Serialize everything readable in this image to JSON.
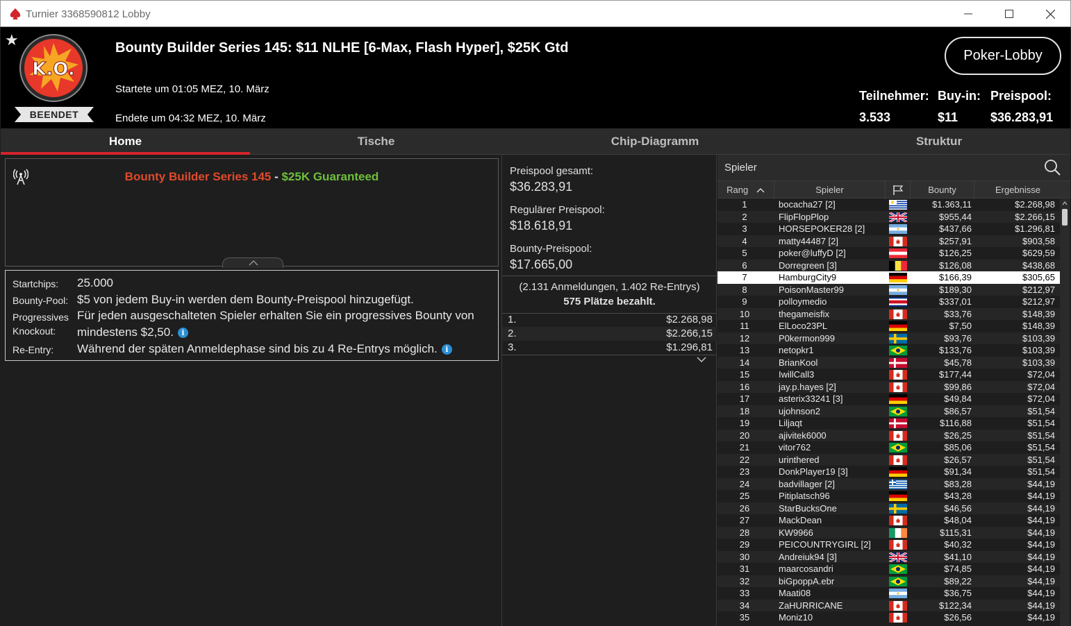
{
  "window": {
    "title": "Turnier 3368590812 Lobby"
  },
  "header": {
    "status": "BEENDET",
    "logo_text": "K.O.",
    "title": "Bounty Builder Series 145: $11 NLHE [6-Max, Flash Hyper], $25K Gtd",
    "started": "Startete um 01:05 MEZ, 10. März",
    "ended": "Endete um 04:32 MEZ, 10. März",
    "lobby_button": "Poker-Lobby",
    "stats": [
      {
        "label": "Teilnehmer:",
        "value": "3.533"
      },
      {
        "label": "Buy-in:",
        "value": "$11"
      },
      {
        "label": "Preispool:",
        "value": "$36.283,91"
      }
    ]
  },
  "tabs": [
    "Home",
    "Tische",
    "Chip-Diagramm",
    "Struktur"
  ],
  "active_tab": "Home",
  "news": {
    "title_red": "Bounty Builder Series 145",
    "title_sep": " - ",
    "title_green": "$25K Guaranteed"
  },
  "info": {
    "startchips_label": "Startchips:",
    "startchips_value": "25.000",
    "bountypool_label": "Bounty-Pool:",
    "bountypool_value": "$5 von jedem Buy-in werden dem Bounty-Preispool hinzugefügt.",
    "progressive_label_1": "Progressives",
    "progressive_label_2": "Knockout:",
    "progressive_value_1": "Für jeden ausgeschalteten Spieler erhalten Sie ein progressives Bounty von",
    "progressive_value_2": "mindestens $2,50.",
    "reentry_label": "Re-Entry:",
    "reentry_value": "Während der späten Anmeldephase sind bis zu 4 Re-Entrys möglich."
  },
  "prizepool": {
    "total_label": "Preispool gesamt:",
    "total_value": "$36.283,91",
    "regular_label": "Regulärer Preispool:",
    "regular_value": "$18.618,91",
    "bounty_label": "Bounty-Preispool:",
    "bounty_value": "$17.665,00",
    "entries": "(2.131 Anmeldungen, 1.402 Re-Entrys)",
    "paid": "575 Plätze bezahlt.",
    "places": [
      {
        "pos": "1.",
        "amount": "$2.268,98"
      },
      {
        "pos": "2.",
        "amount": "$2.266,15"
      },
      {
        "pos": "3.",
        "amount": "$1.296,81"
      }
    ]
  },
  "players": {
    "search_label": "Spieler",
    "columns": [
      "Rang",
      "Spieler",
      "",
      "Bounty",
      "Ergebnisse"
    ],
    "highlighted_rank": "7",
    "rows": [
      {
        "rank": "1",
        "name": "bocacha27 [2]",
        "flag": "uy",
        "bounty": "$1.363,11",
        "result": "$2.268,98"
      },
      {
        "rank": "2",
        "name": "FlipFlopPlop",
        "flag": "gb",
        "bounty": "$955,44",
        "result": "$2.266,15"
      },
      {
        "rank": "3",
        "name": "HORSEPOKER28 [2]",
        "flag": "ar",
        "bounty": "$437,66",
        "result": "$1.296,81"
      },
      {
        "rank": "4",
        "name": "matty44487 [2]",
        "flag": "ca",
        "bounty": "$257,91",
        "result": "$903,58"
      },
      {
        "rank": "5",
        "name": "poker@luffyD [2]",
        "flag": "at",
        "bounty": "$126,25",
        "result": "$629,59"
      },
      {
        "rank": "6",
        "name": "Dorregreen [3]",
        "flag": "be",
        "bounty": "$126,08",
        "result": "$438,68"
      },
      {
        "rank": "7",
        "name": "HamburgCity9",
        "flag": "de",
        "bounty": "$166,39",
        "result": "$305,65"
      },
      {
        "rank": "8",
        "name": "PoisonMaster99",
        "flag": "ar",
        "bounty": "$189,30",
        "result": "$212,97"
      },
      {
        "rank": "9",
        "name": "polloymedio",
        "flag": "cr",
        "bounty": "$337,01",
        "result": "$212,97"
      },
      {
        "rank": "10",
        "name": "thegameisfix",
        "flag": "ca",
        "bounty": "$33,76",
        "result": "$148,39"
      },
      {
        "rank": "11",
        "name": "ElLoco23PL",
        "flag": "de",
        "bounty": "$7,50",
        "result": "$148,39"
      },
      {
        "rank": "12",
        "name": "P0kermon999",
        "flag": "se",
        "bounty": "$93,76",
        "result": "$103,39"
      },
      {
        "rank": "13",
        "name": "netopkr1",
        "flag": "br",
        "bounty": "$133,76",
        "result": "$103,39"
      },
      {
        "rank": "14",
        "name": "BrianKool",
        "flag": "dk",
        "bounty": "$45,78",
        "result": "$103,39"
      },
      {
        "rank": "15",
        "name": "IwillCall3",
        "flag": "ca",
        "bounty": "$177,44",
        "result": "$72,04"
      },
      {
        "rank": "16",
        "name": "jay.p.hayes [2]",
        "flag": "ca",
        "bounty": "$99,86",
        "result": "$72,04"
      },
      {
        "rank": "17",
        "name": "asterix33241 [3]",
        "flag": "de",
        "bounty": "$49,84",
        "result": "$72,04"
      },
      {
        "rank": "18",
        "name": "ujohnson2",
        "flag": "br",
        "bounty": "$86,57",
        "result": "$51,54"
      },
      {
        "rank": "19",
        "name": "Liljaqt",
        "flag": "dk",
        "bounty": "$116,88",
        "result": "$51,54"
      },
      {
        "rank": "20",
        "name": "ajivitek6000",
        "flag": "ca",
        "bounty": "$26,25",
        "result": "$51,54"
      },
      {
        "rank": "21",
        "name": "vitor762",
        "flag": "br",
        "bounty": "$85,06",
        "result": "$51,54"
      },
      {
        "rank": "22",
        "name": "urinthered",
        "flag": "ca",
        "bounty": "$26,57",
        "result": "$51,54"
      },
      {
        "rank": "23",
        "name": "DonkPlayer19 [3]",
        "flag": "de",
        "bounty": "$91,34",
        "result": "$51,54"
      },
      {
        "rank": "24",
        "name": "badvillager [2]",
        "flag": "gr",
        "bounty": "$83,28",
        "result": "$44,19"
      },
      {
        "rank": "25",
        "name": "Pitiplatsch96",
        "flag": "de",
        "bounty": "$43,28",
        "result": "$44,19"
      },
      {
        "rank": "26",
        "name": "StarBucksOne",
        "flag": "se",
        "bounty": "$46,56",
        "result": "$44,19"
      },
      {
        "rank": "27",
        "name": "MackDean",
        "flag": "ca",
        "bounty": "$48,04",
        "result": "$44,19"
      },
      {
        "rank": "28",
        "name": "KW9966",
        "flag": "ie",
        "bounty": "$115,31",
        "result": "$44,19"
      },
      {
        "rank": "29",
        "name": "PEICOUNTRYGIRL [2]",
        "flag": "ca",
        "bounty": "$40,32",
        "result": "$44,19"
      },
      {
        "rank": "30",
        "name": "Andreiuk94 [3]",
        "flag": "gb",
        "bounty": "$41,10",
        "result": "$44,19"
      },
      {
        "rank": "31",
        "name": "maarcosandri",
        "flag": "br",
        "bounty": "$74,85",
        "result": "$44,19"
      },
      {
        "rank": "32",
        "name": "biGpoppA.ebr",
        "flag": "br",
        "bounty": "$89,22",
        "result": "$44,19"
      },
      {
        "rank": "33",
        "name": "Maati08",
        "flag": "ar",
        "bounty": "$36,75",
        "result": "$44,19"
      },
      {
        "rank": "34",
        "name": "ZaHURRICANE",
        "flag": "ca",
        "bounty": "$122,34",
        "result": "$44,19"
      },
      {
        "rank": "35",
        "name": "Moniz10",
        "flag": "ca",
        "bounty": "$26,56",
        "result": "$44,19"
      }
    ]
  },
  "colors": {
    "accent_red": "#d3232a",
    "news_red": "#e04a2a",
    "news_green": "#6fbf3a",
    "info_blue": "#2b8fd6"
  }
}
